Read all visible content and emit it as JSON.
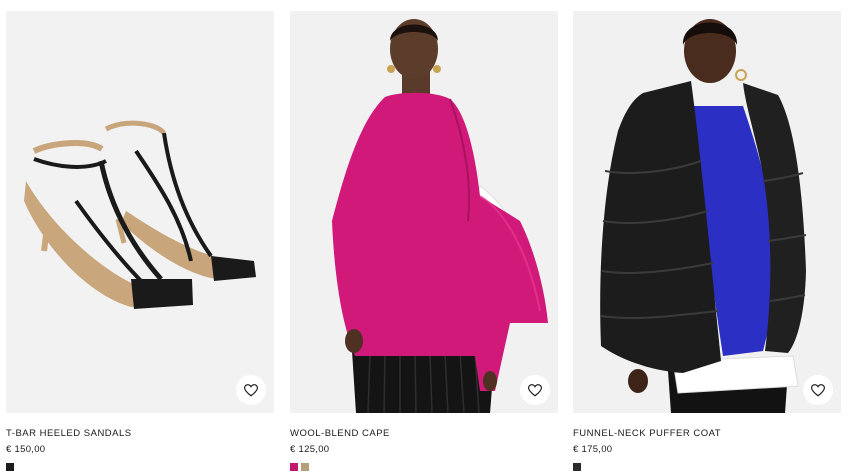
{
  "products": [
    {
      "title": "T-BAR HEELED SANDALS",
      "price": "€ 150,00",
      "image": "black-leather-sandals",
      "swatches": [
        "#1c1c1c"
      ]
    },
    {
      "title": "WOOL-BLEND CAPE",
      "price": "€ 125,00",
      "image": "magenta-wool-cape",
      "swatches": [
        "#c4176e",
        "#b5a077"
      ]
    },
    {
      "title": "FUNNEL-NECK PUFFER COAT",
      "price": "€ 175,00",
      "image": "black-puffer-coat",
      "swatches": [
        "#2b2b2b"
      ]
    }
  ],
  "icons": {
    "favorite": "heart-outline-icon"
  }
}
